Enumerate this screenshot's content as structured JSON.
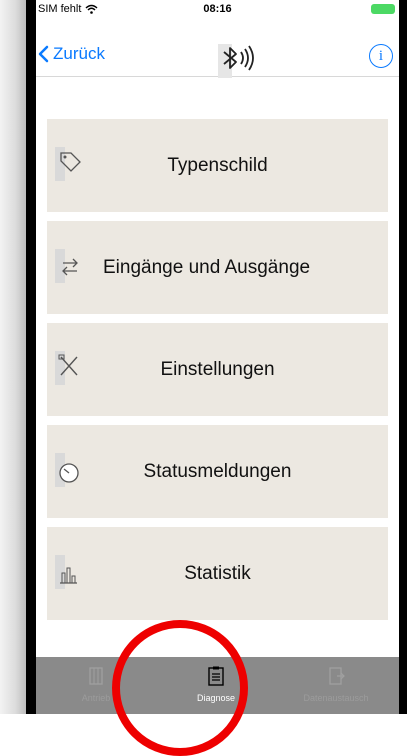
{
  "status": {
    "carrier": "SIM fehlt",
    "time": "08:16"
  },
  "nav": {
    "back_label": "Zurück",
    "info_label": "i"
  },
  "menu": [
    {
      "label": "Typenschild",
      "icon": "tag-icon"
    },
    {
      "label": "Eingänge und Ausgänge",
      "icon": "arrows-icon"
    },
    {
      "label": "Einstellungen",
      "icon": "tools-icon"
    },
    {
      "label": "Statusmeldungen",
      "icon": "gauge-icon"
    },
    {
      "label": "Statistik",
      "icon": "bar-chart-icon"
    }
  ],
  "tabs": [
    {
      "label": "Antrieb",
      "active": false
    },
    {
      "label": "Diagnose",
      "active": true
    },
    {
      "label": "Datenaustausch",
      "active": false
    }
  ],
  "colors": {
    "accent": "#0a7aff",
    "menu_bg": "#ece8e1",
    "tabbar_bg": "#8a8a8a",
    "highlight": "#ee0000",
    "battery": "#4cd964"
  }
}
